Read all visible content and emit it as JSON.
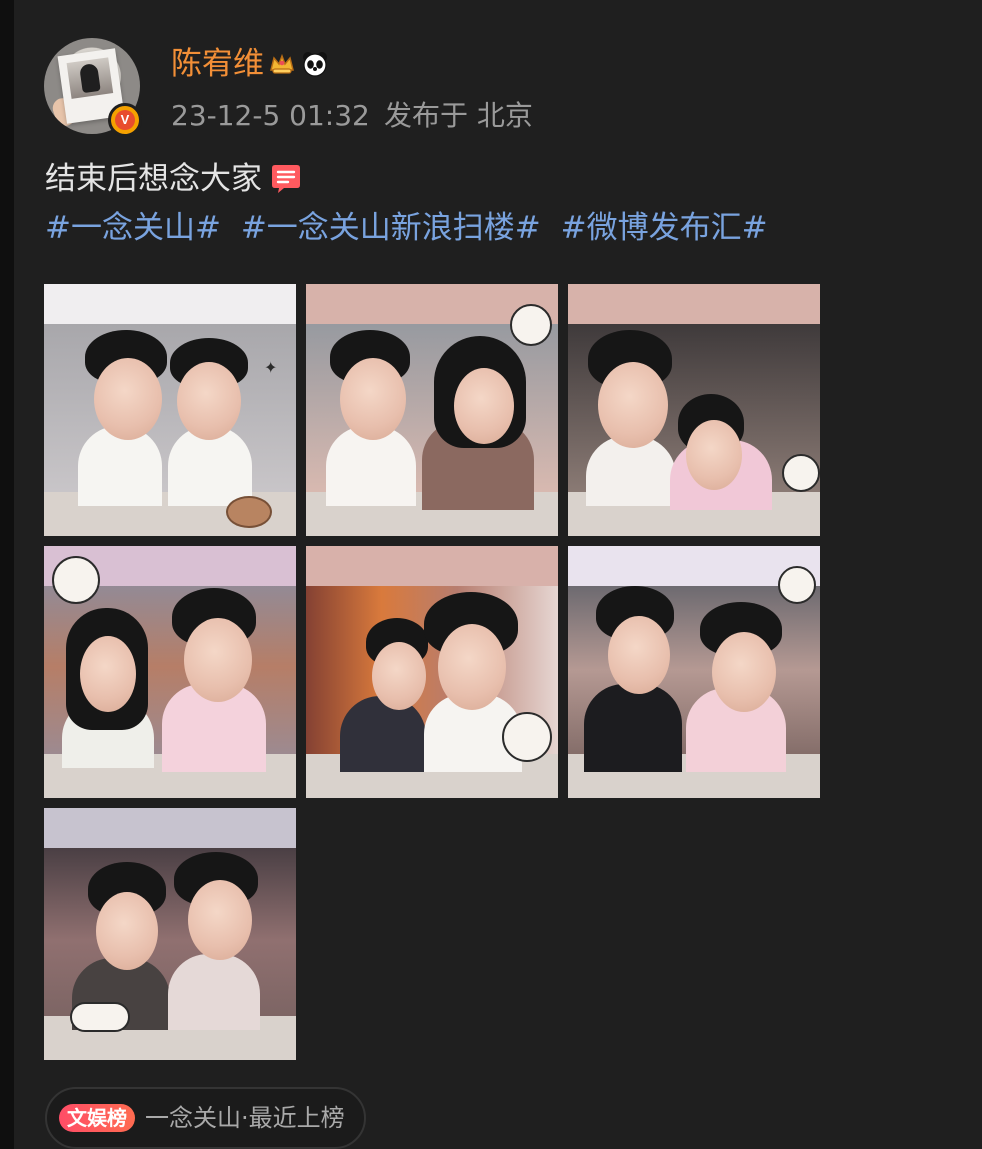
{
  "post": {
    "author": {
      "name": "陈宥维",
      "avatar_icon": "avatar-icon",
      "badges": [
        "crown-icon",
        "panda-icon"
      ],
      "verified_badge_icon": "verified-v-icon"
    },
    "meta": {
      "time": "23-12-5 01:32",
      "location": "发布于 北京"
    },
    "text": {
      "main": "结束后想念大家",
      "emoji_icon": "cute-text-icon"
    },
    "hashtags": [
      "#一念关山#",
      "#一念关山新浪扫楼#",
      "#微博发布汇#"
    ],
    "images": [
      {
        "semantic": "image-1"
      },
      {
        "semantic": "image-2"
      },
      {
        "semantic": "image-3"
      },
      {
        "semantic": "image-4"
      },
      {
        "semantic": "image-5"
      },
      {
        "semantic": "image-6"
      },
      {
        "semantic": "image-7"
      }
    ],
    "ranking": {
      "badge": "文娱榜",
      "text": "一念关山·最近上榜"
    }
  }
}
